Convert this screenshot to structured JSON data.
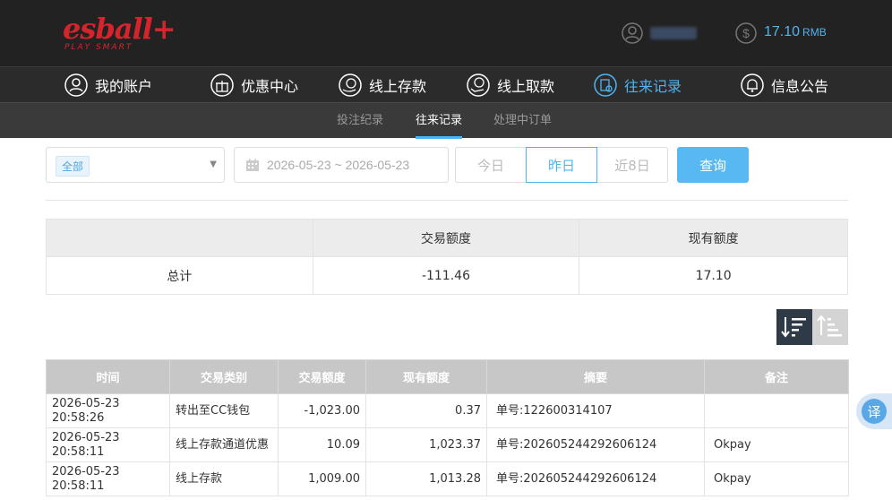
{
  "brand": {
    "name": "esball+",
    "tagline": "PLAY SMART",
    "color": "#d6242c"
  },
  "account": {
    "balance": "17.10",
    "currency": "RMB"
  },
  "main_nav": [
    {
      "label": "我的账户",
      "icon": "user-icon"
    },
    {
      "label": "优惠中心",
      "icon": "gift-icon"
    },
    {
      "label": "线上存款",
      "icon": "deposit-icon"
    },
    {
      "label": "线上取款",
      "icon": "withdraw-icon"
    },
    {
      "label": "往来记录",
      "icon": "records-icon",
      "active": true
    },
    {
      "label": "信息公告",
      "icon": "bell-icon"
    }
  ],
  "sub_nav": [
    {
      "label": "投注纪录"
    },
    {
      "label": "往来记录",
      "active": true
    },
    {
      "label": "处理中订单"
    }
  ],
  "filters": {
    "type_chip": "全部",
    "date_range": "2026-05-23 ~ 2026-05-23",
    "quick_ranges": [
      "今日",
      "昨日",
      "近8日"
    ],
    "active_range": "昨日",
    "query_label": "查询"
  },
  "summary": {
    "headers": [
      "",
      "交易额度",
      "现有额度"
    ],
    "row_label": "总计",
    "transaction_total": "-111.46",
    "current_balance": "17.10"
  },
  "records": {
    "headers": [
      "时间",
      "交易类别",
      "交易额度",
      "现有额度",
      "摘要",
      "备注"
    ],
    "rows": [
      {
        "time": "2026-05-23 20:58:26",
        "type": "转出至CC钱包",
        "amount": "-1,023.00",
        "balance": "0.37",
        "summary": "单号:122600314107",
        "note": ""
      },
      {
        "time": "2026-05-23 20:58:11",
        "type": "线上存款通道优惠",
        "amount": "10.09",
        "balance": "1,023.37",
        "summary": "单号:202605244292606124",
        "note": "Okpay"
      },
      {
        "time": "2026-05-23 20:58:11",
        "type": "线上存款",
        "amount": "1,009.00",
        "balance": "1,013.28",
        "summary": "单号:202605244292606124",
        "note": "Okpay"
      }
    ]
  },
  "translate_label": "译",
  "accent_color": "#4fb4f0"
}
